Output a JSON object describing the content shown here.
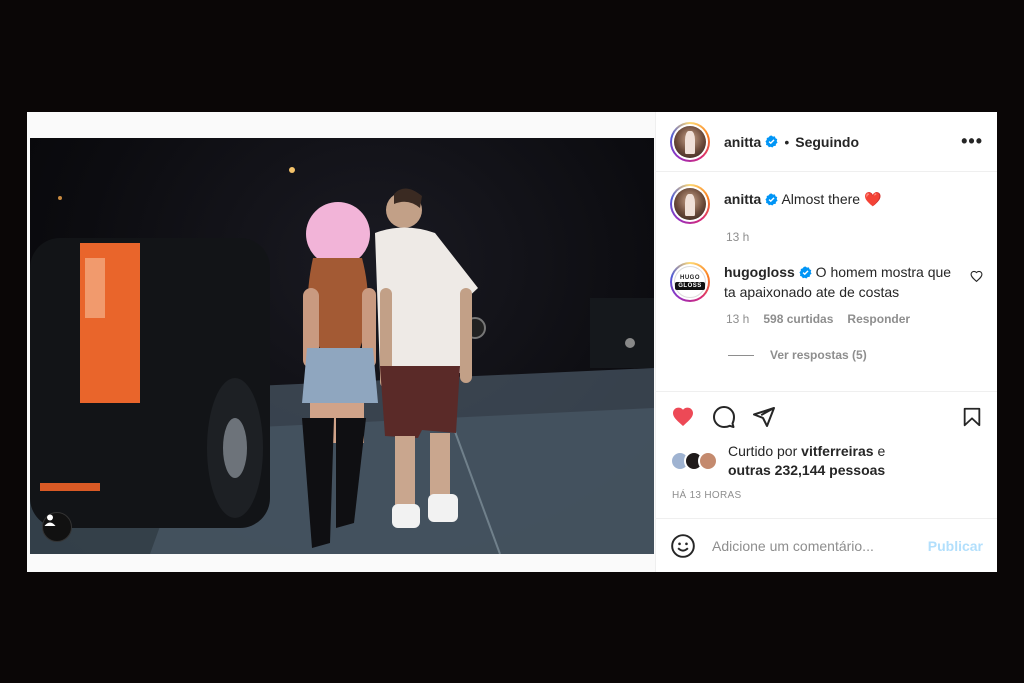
{
  "post": {
    "author": "anitta",
    "follow_separator": "•",
    "follow_status": "Seguindo",
    "more_label": "•••",
    "icons": {
      "verified": "verified-badge-icon",
      "more": "more-options-icon",
      "tag": "user-tag-icon",
      "like": "heart-icon",
      "comment": "comment-icon",
      "share": "share-icon",
      "save": "bookmark-icon",
      "emoji": "emoji-icon",
      "comment_like": "small-heart-icon"
    },
    "colors": {
      "accent": "#0095f6",
      "liked": "#ed4956",
      "muted": "#8e8e8e",
      "text": "#262626"
    }
  },
  "caption": {
    "user": "anitta",
    "text": "Almost there",
    "emoji": "❤️",
    "time": "13 h"
  },
  "comments": [
    {
      "user": "hugogloss",
      "avatar_text_top": "HUGO",
      "avatar_text_bottom": "GLOSS",
      "text": "O homem mostra que ta apaixonado ate de costas",
      "time": "13 h",
      "likes": "598 curtidas",
      "reply_label": "Responder",
      "view_replies": "Ver respostas (5)"
    }
  ],
  "likes": {
    "prefix": "Curtido por",
    "user": "vitferreiras",
    "connector": "e",
    "others": "outras 232,144 pessoas"
  },
  "timestamp": "HÁ 13 HORAS",
  "composer": {
    "placeholder": "Adicione um comentário...",
    "publish": "Publicar"
  }
}
